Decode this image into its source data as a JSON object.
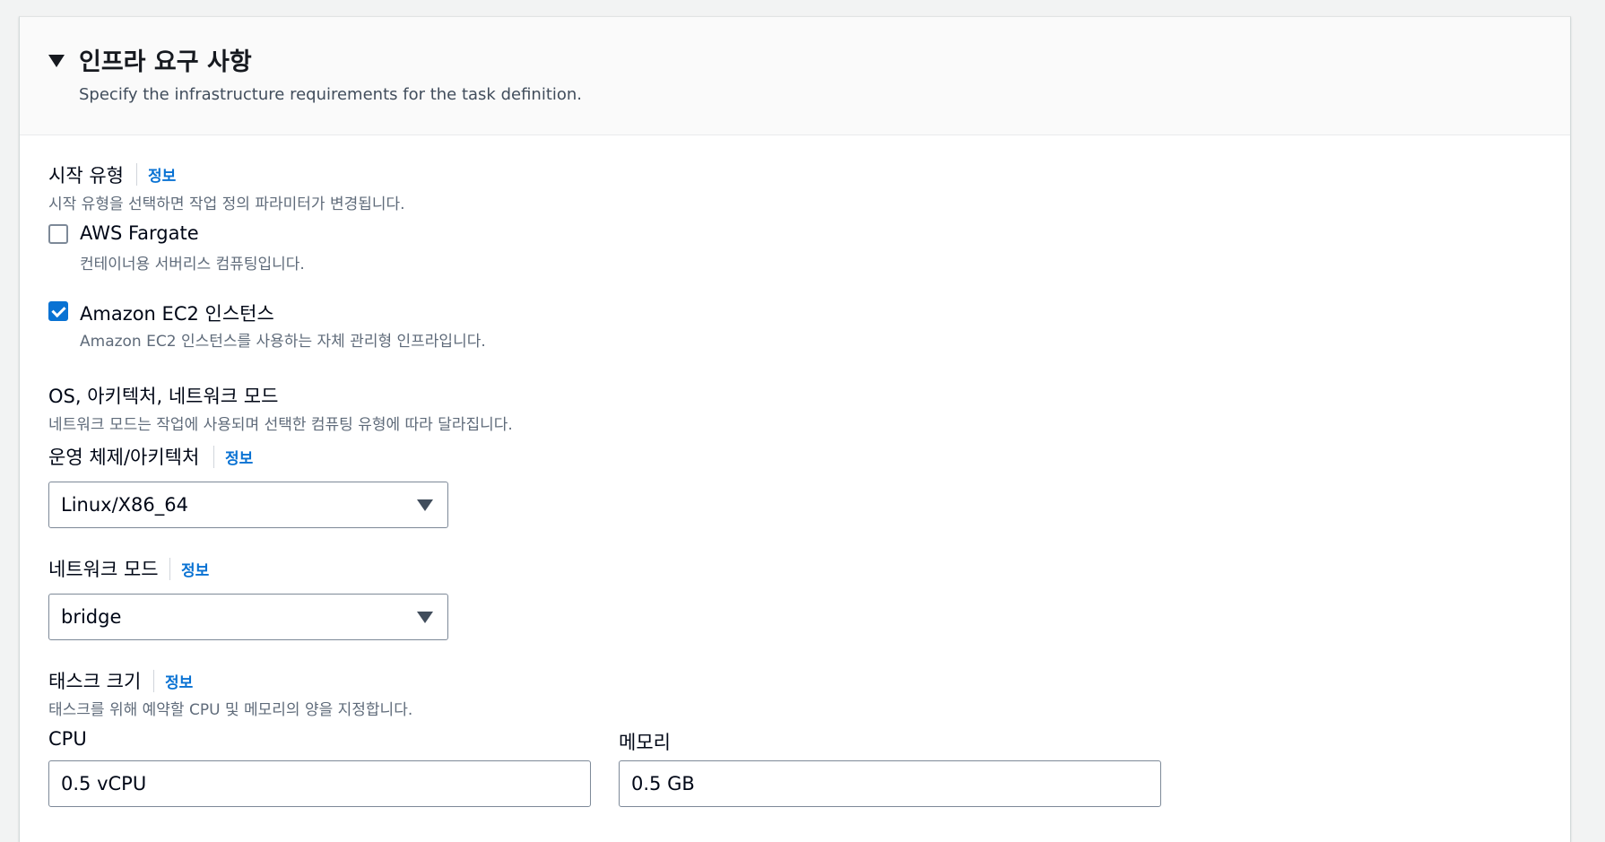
{
  "section": {
    "title": "인프라 요구 사항",
    "description": "Specify the infrastructure requirements for the task definition."
  },
  "launch_type": {
    "label": "시작 유형",
    "info": "정보",
    "description": "시작 유형을 선택하면 작업 정의 파라미터가 변경됩니다.",
    "options": [
      {
        "label": "AWS Fargate",
        "description": "컨테이너용 서버리스 컴퓨팅입니다.",
        "checked": false
      },
      {
        "label": "Amazon EC2 인스턴스",
        "description": "Amazon EC2 인스턴스를 사용하는 자체 관리형 인프라입니다.",
        "checked": true
      }
    ]
  },
  "os_arch_network": {
    "label": "OS, 아키텍처, 네트워크 모드",
    "description": "네트워크 모드는 작업에 사용되며 선택한 컴퓨팅 유형에 따라 달라집니다."
  },
  "os_arch": {
    "label": "운영 체제/아키텍처",
    "info": "정보",
    "value": "Linux/X86_64"
  },
  "network_mode": {
    "label": "네트워크 모드",
    "info": "정보",
    "value": "bridge"
  },
  "task_size": {
    "label": "태스크 크기",
    "info": "정보",
    "description": "태스크를 위해 예약할 CPU 및 메모리의 양을 지정합니다.",
    "cpu_label": "CPU",
    "cpu_value": "0.5 vCPU",
    "memory_label": "메모리",
    "memory_value": "0.5 GB"
  }
}
